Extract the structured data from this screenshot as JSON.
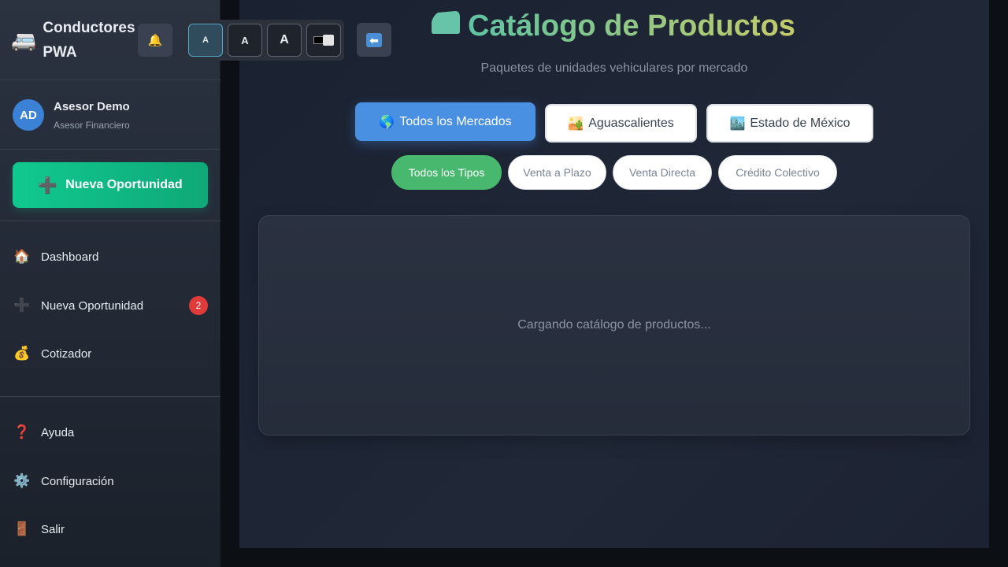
{
  "app": {
    "icon": "🚐",
    "name": "Conductores PWA"
  },
  "toolbar": {
    "notifications_icon": "🔔",
    "font_sizes": [
      "A",
      "A",
      "A"
    ],
    "contrast_icon": "contrast-toggle-icon",
    "back_icon": "⬅"
  },
  "user": {
    "initials": "AD",
    "name": "Asesor Demo",
    "role": "Asesor Financiero"
  },
  "cta": {
    "icon": "➕",
    "label": "Nueva Oportunidad"
  },
  "nav": [
    {
      "icon": "🏠",
      "label": "Dashboard"
    },
    {
      "icon": "➕",
      "label": "Nueva Oportunidad",
      "badge": "2"
    },
    {
      "icon": "💰",
      "label": "Cotizador"
    }
  ],
  "nav_bottom": [
    {
      "icon": "❓",
      "label": "Ayuda"
    },
    {
      "icon": "⚙️",
      "label": "Configuración"
    },
    {
      "icon": "🚪",
      "label": "Salir"
    }
  ],
  "page": {
    "title": "Catálogo de Productos",
    "subtitle": "Paquetes de unidades vehiculares por mercado",
    "markets": [
      {
        "icon": "🌎",
        "label": "Todos los Mercados",
        "active": true
      },
      {
        "icon": "🏜️",
        "label": "Aguascalientes",
        "active": false
      },
      {
        "icon": "🏙️",
        "label": "Estado de México",
        "active": false
      }
    ],
    "types": [
      {
        "label": "Todos los Tipos",
        "active": true
      },
      {
        "label": "Venta a Plazo",
        "active": false
      },
      {
        "label": "Venta Directa",
        "active": false
      },
      {
        "label": "Crédito Colectivo",
        "active": false
      }
    ],
    "loading_text": "Cargando catálogo de productos..."
  },
  "colors": {
    "accent_blue": "#4a90e2",
    "accent_green": "#47b86e",
    "cta_green": "#10c98f",
    "badge_red": "#e03a3a"
  }
}
